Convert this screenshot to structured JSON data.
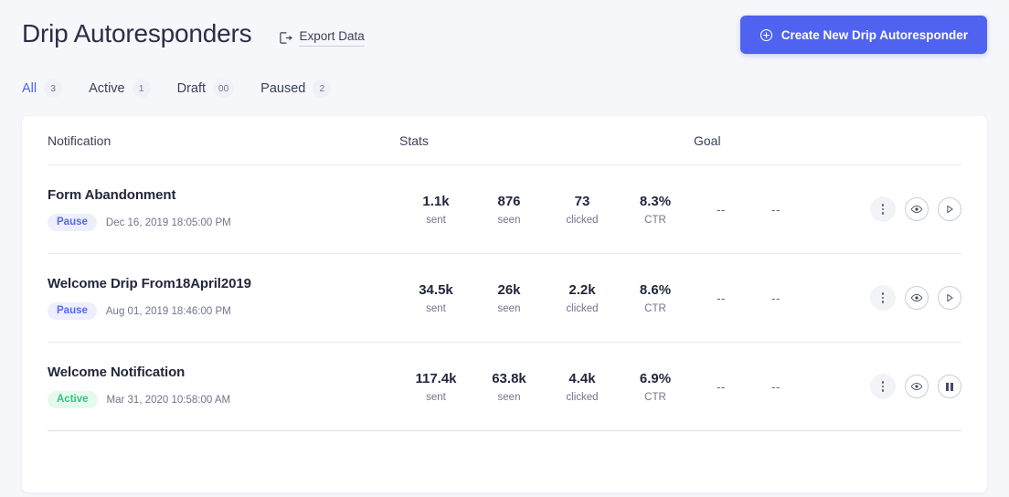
{
  "header": {
    "title": "Drip Autoresponders",
    "export_label": "Export Data",
    "export_icon": "export-document-arrow-icon",
    "create_button_label": "Create New Drip Autoresponder",
    "create_button_icon": "plus-circle-icon",
    "accent_color": "#4f62f0"
  },
  "filters": {
    "tabs": [
      {
        "label": "All",
        "count": "3",
        "active": true
      },
      {
        "label": "Active",
        "count": "1",
        "active": false
      },
      {
        "label": "Draft",
        "count": "00",
        "active": false
      },
      {
        "label": "Paused",
        "count": "2",
        "active": false
      }
    ]
  },
  "table": {
    "columns": {
      "notification": "Notification",
      "stats": "Stats",
      "goal": "Goal"
    },
    "stat_labels": {
      "sent": "sent",
      "seen": "seen",
      "clicked": "clicked",
      "ctr": "CTR"
    },
    "empty_value": "--",
    "rows": [
      {
        "name": "Form Abandonment",
        "status": "Pause",
        "status_type": "pause",
        "date": "Dec 16, 2019 18:05:00 PM",
        "sent": "1.1k",
        "seen": "876",
        "clicked": "73",
        "ctr": "8.3%",
        "goal_1": "--",
        "goal_2": "--",
        "toggle_icon": "play-icon"
      },
      {
        "name": "Welcome Drip From18April2019",
        "status": "Pause",
        "status_type": "pause",
        "date": "Aug 01, 2019 18:46:00 PM",
        "sent": "34.5k",
        "seen": "26k",
        "clicked": "2.2k",
        "ctr": "8.6%",
        "goal_1": "--",
        "goal_2": "--",
        "toggle_icon": "play-icon"
      },
      {
        "name": "Welcome Notification",
        "status": "Active",
        "status_type": "active",
        "date": "Mar 31, 2020 10:58:00 AM",
        "sent": "117.4k",
        "seen": "63.8k",
        "clicked": "4.4k",
        "ctr": "6.9%",
        "goal_1": "--",
        "goal_2": "--",
        "toggle_icon": "pause-icon"
      }
    ]
  },
  "colors": {
    "page_background": "#f6f7fb",
    "card_background": "#ffffff",
    "pause_badge_bg": "#edeeff",
    "pause_badge_text": "#5568f5",
    "active_badge_bg": "#e6f9ef",
    "active_badge_text": "#34c47c"
  }
}
